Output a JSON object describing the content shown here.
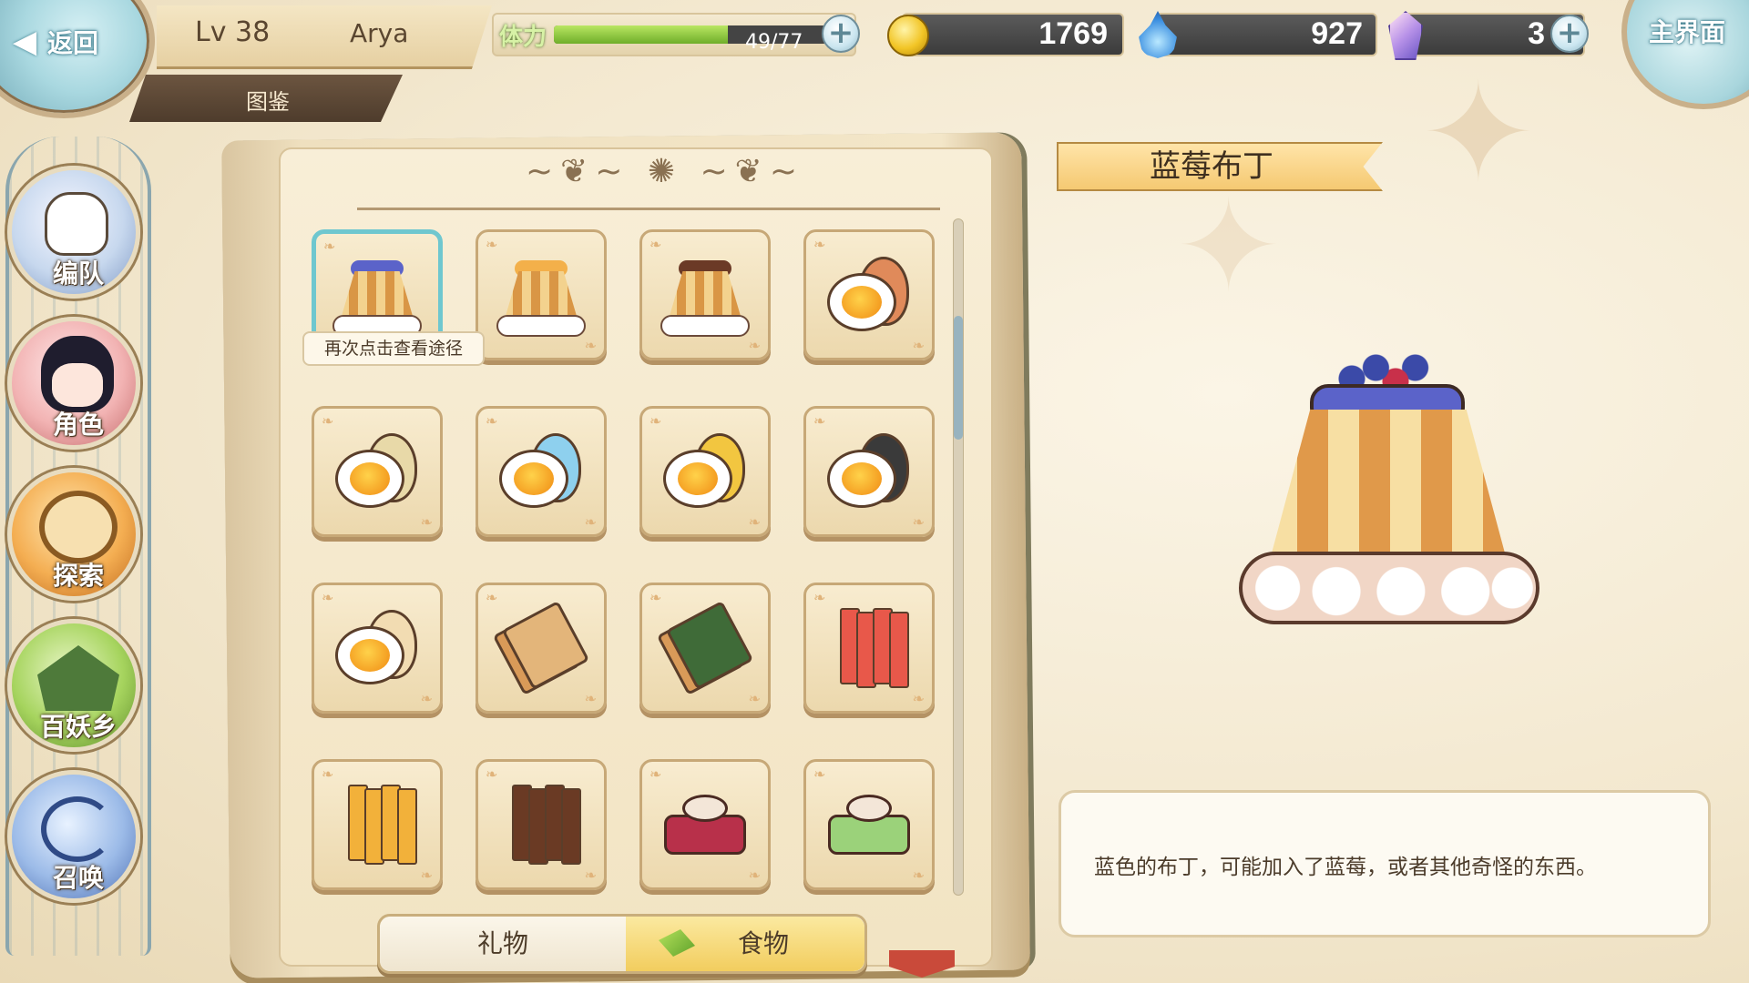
{
  "header": {
    "back_label": "返回",
    "level": "Lv 38",
    "player_name": "Arya",
    "section_tab": "图鉴",
    "home_label": "主界面"
  },
  "resources": {
    "stamina_label": "体力",
    "stamina_text": "49/77",
    "stamina_fraction": 0.636,
    "coins": "1769",
    "soul_fire": "927",
    "gems": "3"
  },
  "sidebar": {
    "items": [
      {
        "label": "编队",
        "icon": "team-icon"
      },
      {
        "label": "角色",
        "icon": "character-icon"
      },
      {
        "label": "探索",
        "icon": "explore-icon"
      },
      {
        "label": "百妖乡",
        "icon": "village-icon"
      },
      {
        "label": "召唤",
        "icon": "summon-icon"
      }
    ]
  },
  "collection": {
    "tooltip": "再次点击查看途径",
    "items": [
      {
        "name": "blueberry-pudding",
        "kind": "pudding",
        "top": "#5b63c9",
        "selected": true
      },
      {
        "name": "orange-pudding",
        "kind": "pudding",
        "top": "#f3b04a",
        "selected": false
      },
      {
        "name": "chocolate-pudding",
        "kind": "pudding",
        "top": "#6b3a26",
        "selected": false
      },
      {
        "name": "red-egg",
        "kind": "egg",
        "shell": "#e08a5a",
        "selected": false
      },
      {
        "name": "quail-egg",
        "kind": "egg",
        "shell": "#e8d9a8",
        "selected": false
      },
      {
        "name": "blue-egg",
        "kind": "egg",
        "shell": "#8ed0ee",
        "selected": false
      },
      {
        "name": "golden-egg",
        "kind": "egg",
        "shell": "#f2c640",
        "selected": false
      },
      {
        "name": "century-egg",
        "kind": "egg",
        "shell": "#3a3a3a",
        "selected": false
      },
      {
        "name": "boiled-egg",
        "kind": "egg",
        "shell": "#f2dcb2",
        "selected": false
      },
      {
        "name": "sauce-toast",
        "kind": "slab",
        "color": "#e3b57a",
        "selected": false
      },
      {
        "name": "seaweed-toast",
        "kind": "slab",
        "color": "#3f6b38",
        "selected": false
      },
      {
        "name": "red-sticks",
        "kind": "sticks",
        "color": "#e8584a",
        "selected": false
      },
      {
        "name": "honey-sticks",
        "kind": "sticks",
        "color": "#f2b13a",
        "selected": false
      },
      {
        "name": "chocolate-sticks",
        "kind": "sticks",
        "color": "#6a3a24",
        "selected": false
      },
      {
        "name": "berry-cake",
        "kind": "cake",
        "color": "#b8304a",
        "selected": false
      },
      {
        "name": "matcha-macaron-plate",
        "kind": "cake",
        "color": "#9bd27a",
        "selected": false
      }
    ]
  },
  "tabs": {
    "gift_label": "礼物",
    "food_label": "食物",
    "active": "food"
  },
  "detail": {
    "title": "蓝莓布丁",
    "description": "蓝色的布丁，可能加入了蓝莓，或者其他奇怪的东西。"
  },
  "colors": {
    "accent_selected": "#6fc7cf",
    "stamina_green": "#8cc63f"
  }
}
